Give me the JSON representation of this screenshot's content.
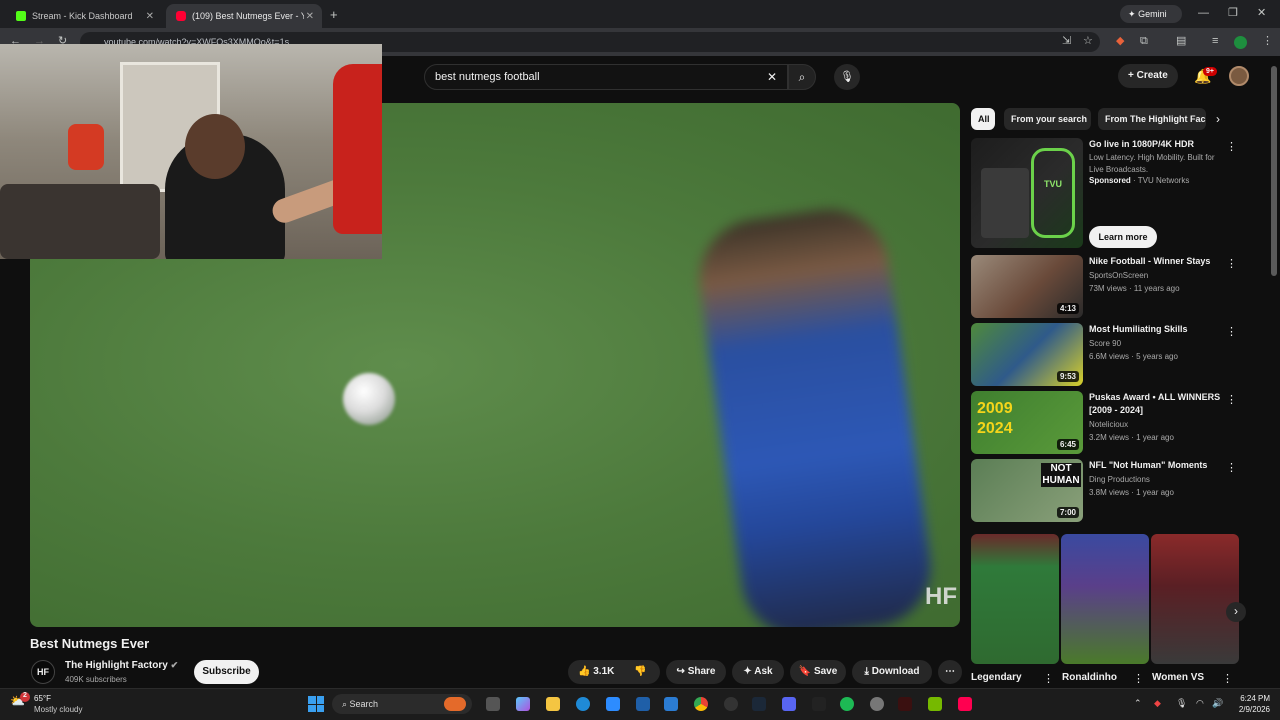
{
  "browser": {
    "tabs": [
      {
        "title": "Stream - Kick Dashboard",
        "color": "#53fc18"
      },
      {
        "title": "(109) Best Nutmegs Ever - YouT",
        "color": "#ff0033"
      }
    ],
    "gemini_label": "Gemini",
    "url": "youtube.com/watch?v=XWFOs3XMMOo&t=1s"
  },
  "youtube": {
    "search_value": "best nutmegs football",
    "create_label": "Create",
    "notifications_badge": "9+",
    "video": {
      "title": "Best Nutmegs Ever",
      "watermark": "HF",
      "channel": "The Highlight Factory",
      "subscribers": "409K subscribers",
      "subscribe_label": "Subscribe",
      "likes": "3.1K",
      "share_label": "Share",
      "ask_label": "Ask",
      "save_label": "Save",
      "download_label": "Download"
    },
    "chips": [
      "All",
      "From your search",
      "From The Highlight Fac"
    ],
    "ad": {
      "title": "Go live in 1080P/4K HDR",
      "description": "Low Latency. High Mobility. Built for Live Broadcasts.",
      "sponsored": "Sponsored",
      "advertiser": "TVU Networks",
      "cta": "Learn more",
      "thumb_text": "TVU"
    },
    "recommendations": [
      {
        "title": "Nike Football - Winner Stays",
        "channel": "SportsOnScreen",
        "meta": "73M views · 11 years ago",
        "duration": "4:13",
        "color": "#7a5a4a"
      },
      {
        "title": "Most Humiliating Skills",
        "channel": "Score 90",
        "meta": "6.6M views · 5 years ago",
        "duration": "9:53",
        "color": "#4f8a3b"
      },
      {
        "title": "Puskas Award • ALL WINNERS [2009 - 2024]",
        "channel": "Noteliciouх",
        "meta": "3.2M views · 1 year ago",
        "duration": "6:45",
        "color": "#3f7f2f",
        "thumb_text": "2009 2024"
      },
      {
        "title": "NFL \"Not Human\" Moments",
        "channel": "Ding Productions",
        "meta": "3.8M views · 1 year ago",
        "duration": "7:00",
        "color": "#5b7e55",
        "thumb_text": "NOT HUMAN"
      }
    ],
    "shorts": [
      {
        "label": "Legendary",
        "color": "#2f7a3a"
      },
      {
        "label": "Ronaldinho",
        "color": "#3a2f6a"
      },
      {
        "label": "Women VS",
        "color": "#6a1f24"
      }
    ]
  },
  "taskbar": {
    "weather_temp": "65°F",
    "weather_desc": "Mostly cloudy",
    "weather_badge": "2",
    "search_label": "Search",
    "time": "6:24 PM",
    "date": "2/9/2026"
  }
}
